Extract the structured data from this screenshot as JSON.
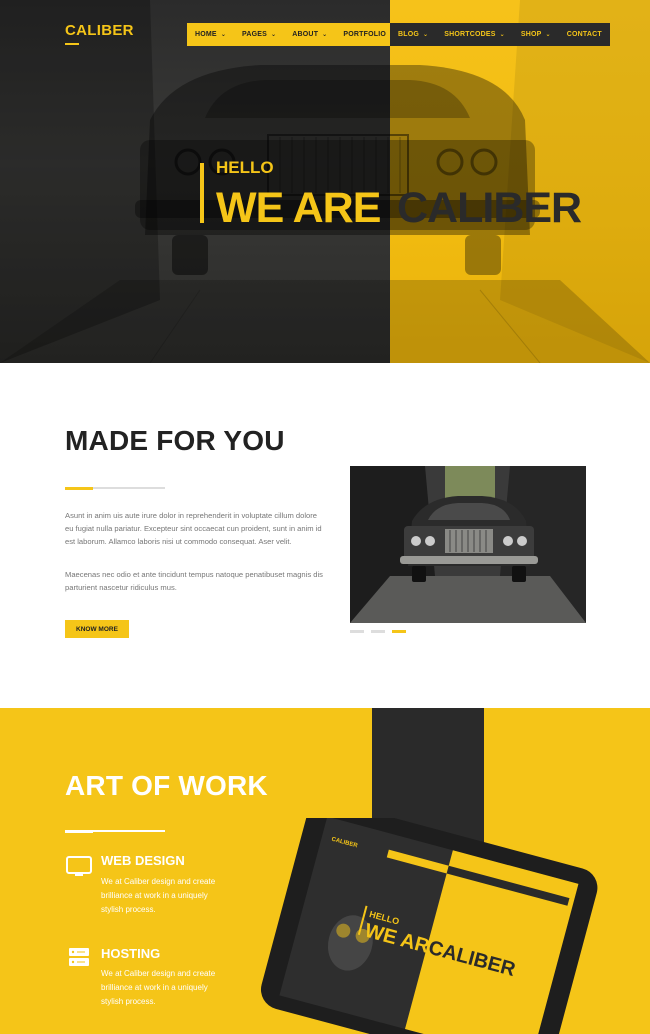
{
  "brand": {
    "logo": "CALIBER",
    "accent": "#f5c518",
    "dark": "#2a2a2a"
  },
  "nav": {
    "items_yellow": [
      {
        "label": "HOME",
        "chevron": true
      },
      {
        "label": "PAGES",
        "chevron": true
      },
      {
        "label": "ABOUT",
        "chevron": true
      },
      {
        "label": "PORTFOLIO",
        "chevron": true
      }
    ],
    "items_dark": [
      {
        "label": "BLOG",
        "chevron": true
      },
      {
        "label": "SHORTCODES",
        "chevron": true
      },
      {
        "label": "SHOP",
        "chevron": true
      },
      {
        "label": "CONTACT",
        "chevron": false
      }
    ]
  },
  "hero": {
    "hello": "HELLO",
    "title_part1": "WE ARE",
    "title_part2": "CALIBER"
  },
  "about": {
    "title": "MADE FOR YOU",
    "paragraph1": "Asunt in anim uis aute irure dolor in reprehenderit in voluptate cillum dolore eu fugiat nulla pariatur. Excepteur sint occaecat cun proident, sunt in anim id est laborum. Allamco laboris nisi ut commodo consequat. Aser velit.",
    "paragraph2": "Maecenas nec odio et ante tincidunt tempus natoque penatibuset magnis dis parturient nascetur ridiculus mus.",
    "button": "KNOW MORE",
    "slider_dots": 3,
    "active_dot": 3
  },
  "work": {
    "title": "ART OF WORK",
    "services": [
      {
        "icon": "monitor-icon",
        "title": "WEB DESIGN",
        "text": "We at Caliber design and create brilliance at work in a uniquely stylish process."
      },
      {
        "icon": "server-icon",
        "title": "HOSTING",
        "text": "We at Caliber design and create brilliance at work in a uniquely stylish process."
      }
    ]
  },
  "tablet_screen": {
    "logo": "CALIBER",
    "hello": "HELLO",
    "title_part1": "WE ARE",
    "title_part2": "CALIBER"
  }
}
